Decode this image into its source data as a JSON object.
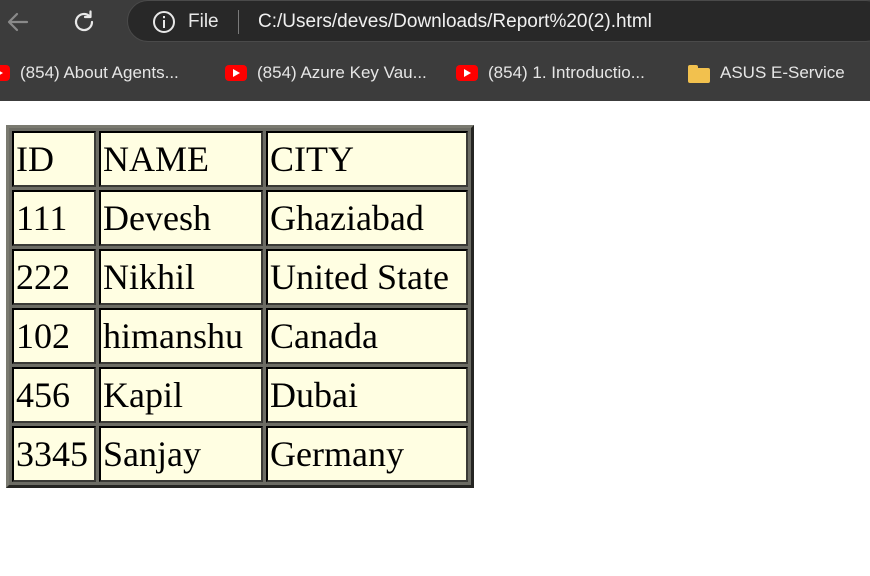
{
  "browser": {
    "back_icon": "arrow-left-icon",
    "reload_icon": "reload-icon",
    "info_icon": "info-icon",
    "file_label": "File",
    "url": "C:/Users/deves/Downloads/Report%20(2).html",
    "bookmarks": [
      {
        "label": "(854) About Agents...",
        "icon": "youtube-icon"
      },
      {
        "label": "(854) Azure Key Vau...",
        "icon": "youtube-icon"
      },
      {
        "label": "(854) 1. Introductio...",
        "icon": "youtube-icon"
      },
      {
        "label": "ASUS E-Service",
        "icon": "folder-icon"
      }
    ]
  },
  "table": {
    "headers": [
      "ID",
      "NAME",
      "CITY"
    ],
    "rows": [
      [
        "111",
        "Devesh",
        "Ghaziabad"
      ],
      [
        "222",
        "Nikhil",
        "United State"
      ],
      [
        "102",
        "himanshu",
        "Canada"
      ],
      [
        "456",
        "Kapil",
        "Dubai"
      ],
      [
        "3345",
        "Sanjay",
        "Germany"
      ]
    ]
  },
  "colors": {
    "chrome_bg": "#3c3c3c",
    "omnibox_bg": "#282828",
    "cell_bg": "#fffee2",
    "youtube_red": "#ff0000",
    "folder_yellow": "#f2c14e"
  }
}
